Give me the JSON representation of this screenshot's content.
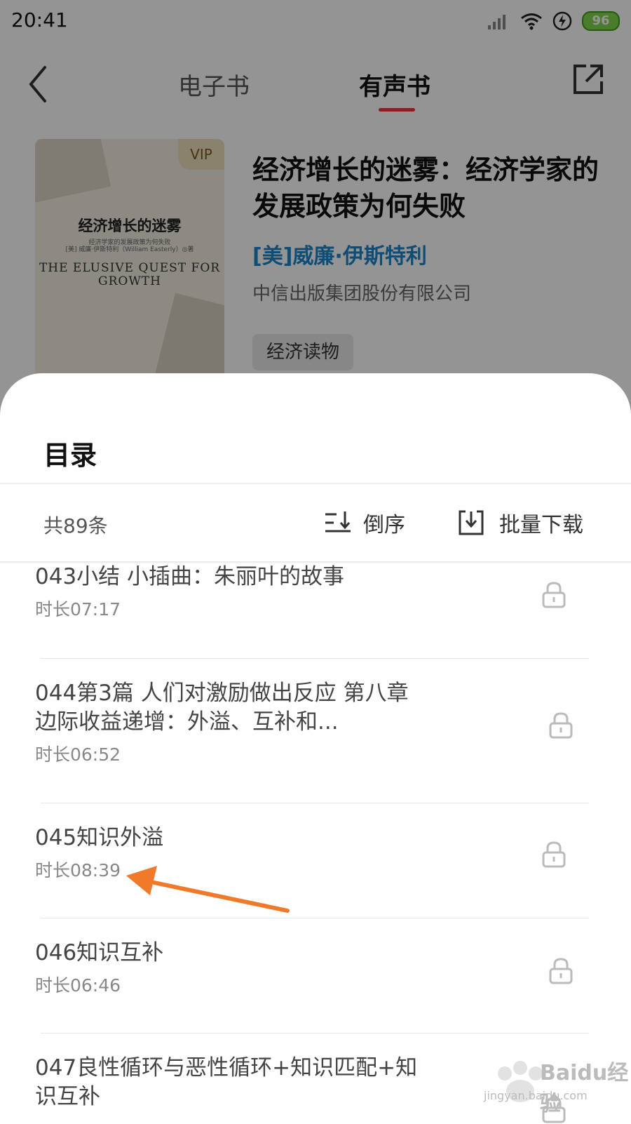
{
  "status_bar": {
    "time": "20:41",
    "battery": "96"
  },
  "header": {
    "tab_ebook": "电子书",
    "tab_audiobook": "有声书",
    "active_tab": "有声书"
  },
  "book": {
    "vip_badge": "VIP",
    "cover_title": "经济增长的迷雾",
    "cover_subtitle": "经济学家的发展政策为何失败",
    "cover_author": "[美] 威廉·伊斯特利（William Easterly）◎著",
    "cover_english": "THE ELUSIVE QUEST FOR GROWTH",
    "title": "经济增长的迷雾：经济学家的发展政策为何失败",
    "author": "[美]威廉·伊斯特利",
    "publisher": "中信出版集团股份有限公司",
    "category": "经济读物"
  },
  "catalog": {
    "title": "目录",
    "count": "共89条",
    "sort_label": "倒序",
    "download_label": "批量下载",
    "items": [
      {
        "title": "043小结 小插曲：朱丽叶的故事",
        "duration": "时长07:17"
      },
      {
        "title": "044第3篇 人们对激励做出反应 第八章 边际收益递增：外溢、互补和...",
        "duration": "时长06:52"
      },
      {
        "title": "045知识外溢",
        "duration": "时长08:39"
      },
      {
        "title": "046知识互补",
        "duration": "时长06:46"
      },
      {
        "title": "047良性循环与恶性循环+知识匹配+知识互补",
        "duration": ""
      }
    ]
  },
  "watermark": {
    "brand": "Baidu经验",
    "url": "jingyan.baidu.com"
  },
  "colors": {
    "accent": "#e63939",
    "author": "#1a86c8",
    "arrow": "#f07a2a"
  }
}
